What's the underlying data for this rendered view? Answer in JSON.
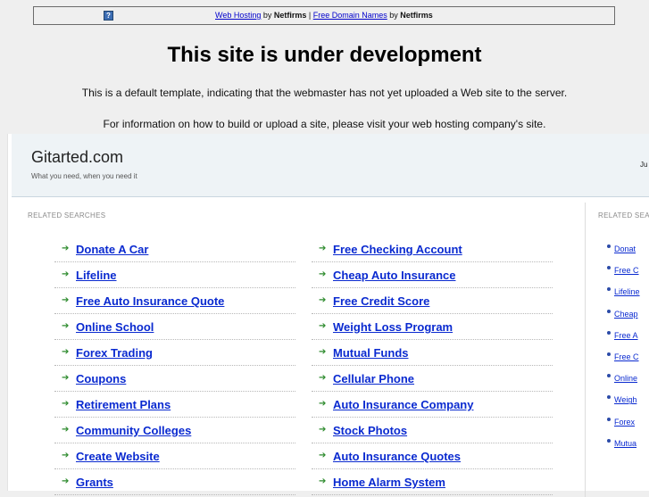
{
  "topbar": {
    "link1": "Web Hosting",
    "by1": " by ",
    "brand1": "Netfirms",
    "sep": " | ",
    "link2": "Free Domain Names",
    "by2": " by ",
    "brand2": "Netfirms",
    "icon": "?"
  },
  "headline": "This site is under development",
  "desc1": "This is a default template, indicating that the webmaster has not yet uploaded a Web site to the server.",
  "desc2": "For information on how to build or upload a site, please visit your web hosting company's site.",
  "site": {
    "title": "Gitarted.com",
    "tagline": "What you need, when you need it",
    "right_text": "Ju"
  },
  "related_title": "RELATED SEARCHES",
  "related_title_right": "RELATED SEA",
  "col_a": [
    "Donate A Car",
    "Lifeline",
    "Free Auto Insurance Quote",
    "Online School",
    "Forex Trading",
    "Coupons",
    "Retirement Plans",
    "Community Colleges",
    "Create Website",
    "Grants"
  ],
  "col_b": [
    "Free Checking Account",
    "Cheap Auto Insurance",
    "Free Credit Score",
    "Weight Loss Program",
    "Mutual Funds",
    "Cellular Phone",
    "Auto Insurance Company",
    "Stock Photos",
    "Auto Insurance Quotes",
    "Home Alarm System"
  ],
  "right_list": [
    "Donat",
    "Free C",
    "Lifeline",
    "Cheap",
    "Free A",
    "Free C",
    "Online",
    "Weigh",
    "Forex",
    "Mutua"
  ],
  "colors": {
    "link": "#0a2ad0",
    "arrow": "#2c8a2c",
    "header_bg": "#eef3f6"
  }
}
